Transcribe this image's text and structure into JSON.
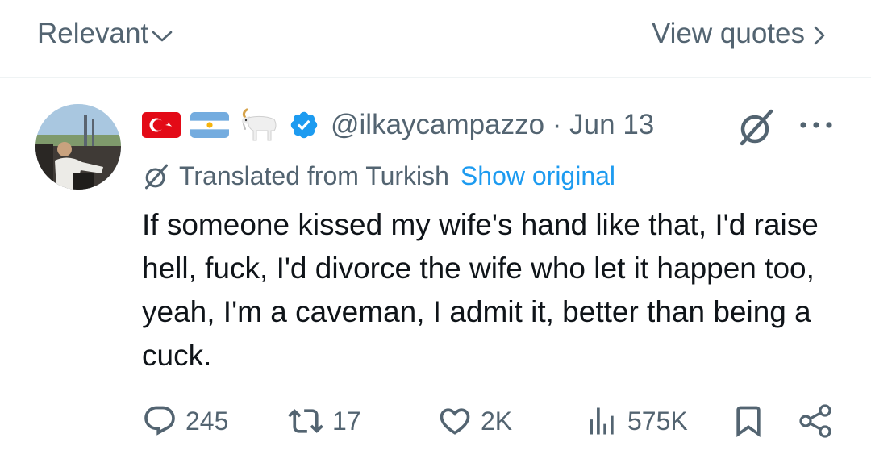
{
  "header": {
    "sort_label": "Relevant",
    "view_quotes_label": "View quotes"
  },
  "tweet": {
    "badges": [
      "flag-turkey-icon",
      "flag-argentina-icon",
      "goat-emoji",
      "verified-icon"
    ],
    "handle_date": "@ilkaycampazzo · Jun 13",
    "translated_label": "Translated from Turkish",
    "show_original_label": "Show original",
    "text": "If someone kissed my wife's hand like that, I'd raise hell, fuck, I'd divorce the wife who let it happen too, yeah, I'm a caveman, I admit it, better than being a cuck.",
    "stats": {
      "replies": "245",
      "reposts": "17",
      "likes": "2K",
      "views": "575K"
    }
  },
  "colors": {
    "text": "#0f1419",
    "secondary": "#536471",
    "accent": "#1d9bf0",
    "divider": "#eff3f4"
  }
}
